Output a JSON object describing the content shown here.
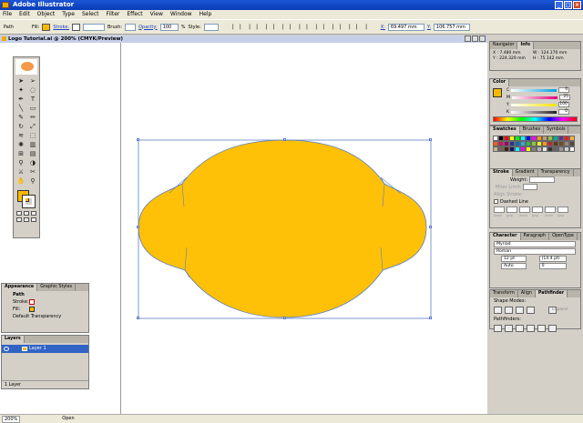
{
  "app": {
    "title": "Adobe Illustrator",
    "window_buttons": [
      "_",
      "□",
      "×"
    ]
  },
  "menu": [
    "File",
    "Edit",
    "Object",
    "Type",
    "Select",
    "Filter",
    "Effect",
    "View",
    "Window",
    "Help"
  ],
  "control": {
    "selection": "Path",
    "fill_label": "Fill:",
    "stroke_label": "Stroke:",
    "brush_label": "Brush:",
    "opacity_label": "Opacity:",
    "opacity_value": "100",
    "opacity_unit": "%",
    "style_label": "Style:",
    "x_label": "X:",
    "x_value": "69.497 mm",
    "y_label": "Y:",
    "y_value": "106.757 mm",
    "fill_color": "#f9b800"
  },
  "document": {
    "tab_title": "Logo Tutorial.ai @ 200% (CMYK/Preview)"
  },
  "canvas": {
    "shape_color": "#ffc107",
    "path_color": "#5b7fc4"
  },
  "status": {
    "zoom": "200%",
    "info": "Open"
  },
  "panels": {
    "navigator": {
      "tabs": [
        "Navigator",
        "Info"
      ],
      "x": "X : 7.480 mm",
      "y": "Y : 224.329 mm",
      "w": "W : 124.170 mm",
      "h": "H : 75.142 mm"
    },
    "color": {
      "tab": "Color",
      "sliders": [
        {
          "label": "C",
          "value": "0",
          "color": "#00a0e0"
        },
        {
          "label": "M",
          "value": "25",
          "color": "#e0007a"
        },
        {
          "label": "Y",
          "value": "100",
          "color": "#f5e400"
        },
        {
          "label": "K",
          "value": "0",
          "color": "#222222"
        }
      ]
    },
    "swatches": {
      "tabs": [
        "Swatches",
        "Brushes",
        "Symbols"
      ],
      "colors": [
        "#ffffff",
        "#000000",
        "#ff0000",
        "#ffff00",
        "#00ff00",
        "#00ffff",
        "#0000ff",
        "#ff00ff",
        "#f7941d",
        "#c69c6d",
        "#8dc63f",
        "#00a99d",
        "#662d91",
        "#ed1c24",
        "#fbb03b",
        "#f15a24",
        "#d4145a",
        "#9e005d",
        "#2e3192",
        "#0071bc",
        "#29abe2",
        "#39b54a",
        "#8cc63f",
        "#fcee21",
        "#f7931e",
        "#c1272d",
        "#603813",
        "#754c24",
        "#998675",
        "#534741",
        "#c7b299",
        "#736357",
        "#42210b",
        "#1b1464",
        "#00ffff",
        "#ff00ff",
        "#ffff00",
        "#808080",
        "#b3b3b3",
        "#e6e6e6",
        "#333333",
        "#666666",
        "#999999",
        "#cccccc",
        "#f2f2f2"
      ]
    },
    "stroke": {
      "tabs": [
        "Stroke",
        "Gradient",
        "Transparency"
      ],
      "weight_label": "Weight:",
      "miter_label": "Miter Limit:",
      "align_label": "Align Stroke:",
      "dashed_label": "Dashed Line",
      "dash_labels": [
        "dash",
        "gap",
        "dash",
        "gap",
        "dash",
        "gap"
      ]
    },
    "character": {
      "tabs": [
        "Character",
        "Paragraph",
        "OpenType"
      ],
      "font": "Myriad",
      "style": "Roman",
      "size": "12 pt",
      "leading": "(14.4 pt)",
      "kerning": "Auto",
      "tracking": "0"
    },
    "pathfinder": {
      "tabs": [
        "Transform",
        "Align",
        "Pathfinder"
      ],
      "shape_modes_label": "Shape Modes:",
      "pathfinders_label": "Pathfinders:",
      "expand_label": "Expand"
    },
    "appearance": {
      "tabs": [
        "Appearance",
        "Graphic Styles"
      ],
      "item": "Path",
      "stroke_label": "Stroke:",
      "fill_label": "Fill:",
      "transparency_label": "Default Transparency"
    },
    "layers": {
      "tab": "Layers",
      "layer_name": "Layer 1",
      "footer": "1 Layer"
    }
  }
}
